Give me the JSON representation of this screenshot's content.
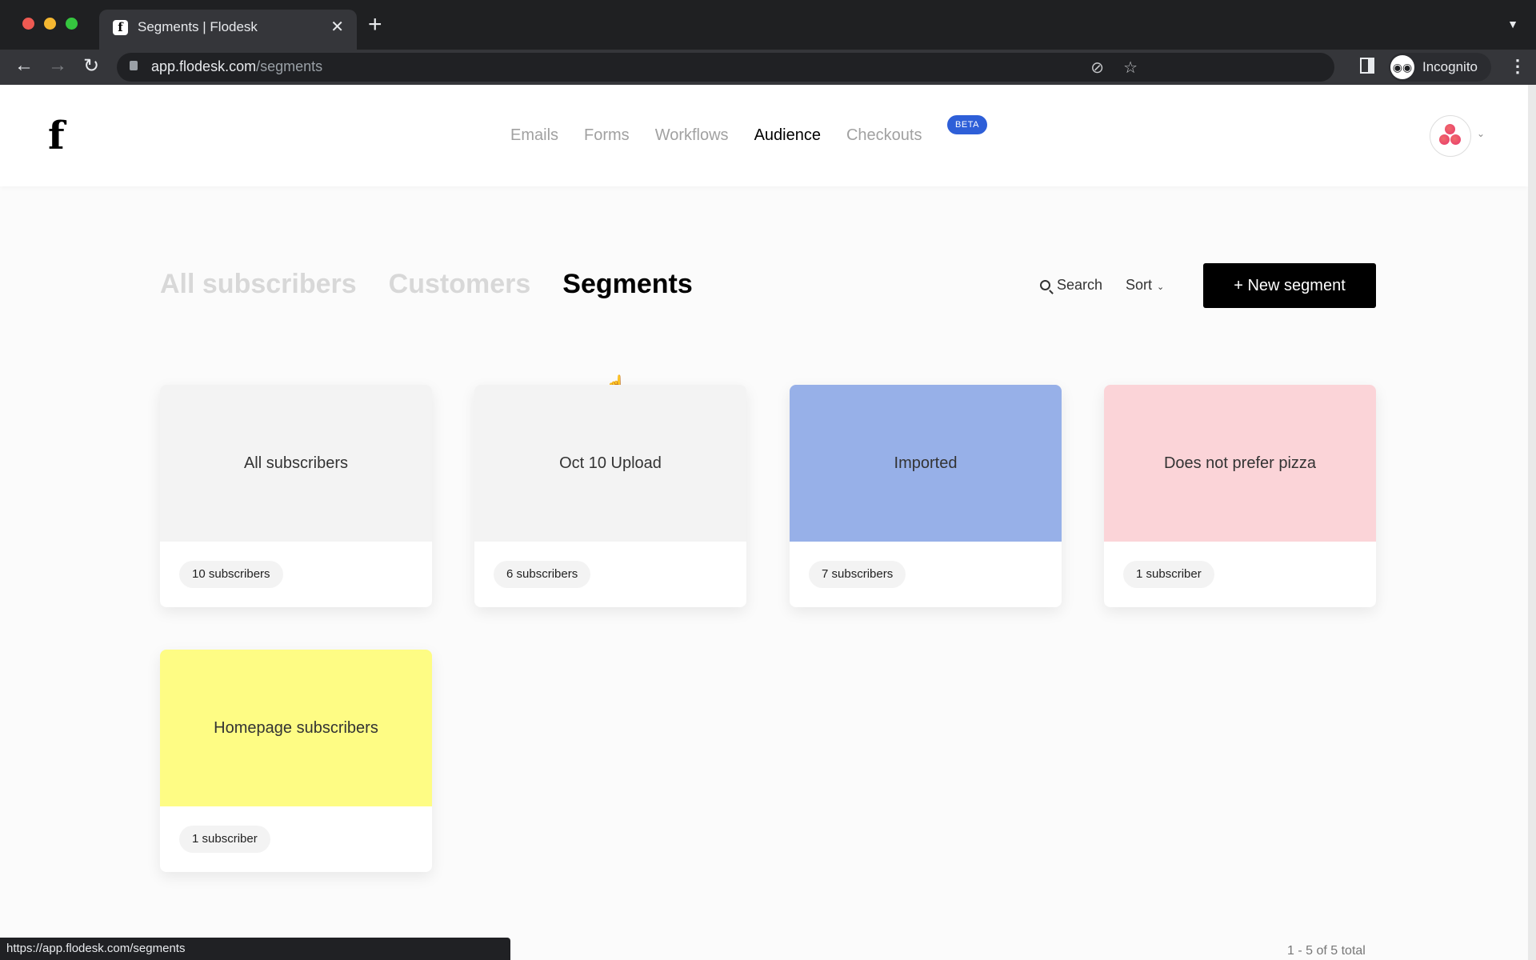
{
  "browser": {
    "tab_title": "Segments | Flodesk",
    "tab_favicon": "f",
    "url_host": "app.flodesk.com",
    "url_path": "/segments",
    "profile_label": "Incognito",
    "status_url": "https://app.flodesk.com/segments"
  },
  "header": {
    "logo": "f",
    "nav": [
      {
        "label": "Emails",
        "active": false
      },
      {
        "label": "Forms",
        "active": false
      },
      {
        "label": "Workflows",
        "active": false
      },
      {
        "label": "Audience",
        "active": true
      },
      {
        "label": "Checkouts",
        "active": false
      }
    ],
    "beta_badge": "BETA",
    "beta_color": "#2e5fd8"
  },
  "subtabs": [
    {
      "label": "All subscribers",
      "active": false
    },
    {
      "label": "Customers",
      "active": false
    },
    {
      "label": "Segments",
      "active": true
    }
  ],
  "toolbar": {
    "search_label": "Search",
    "sort_label": "Sort",
    "new_segment_label": "+ New segment"
  },
  "segments": [
    {
      "name": "All subscribers",
      "count": "10 subscribers",
      "color": "#f3f3f3"
    },
    {
      "name": "Oct 10 Upload",
      "count": "6 subscribers",
      "color": "#f3f3f3"
    },
    {
      "name": "Imported",
      "count": "7 subscribers",
      "color": "#97b0e8"
    },
    {
      "name": "Does not prefer pizza",
      "count": "1 subscriber",
      "color": "#fbd4d8"
    },
    {
      "name": "Homepage subscribers",
      "count": "1 subscriber",
      "color": "#fefc84"
    }
  ],
  "pagination": {
    "summary": "1 - 5 of 5 total"
  }
}
